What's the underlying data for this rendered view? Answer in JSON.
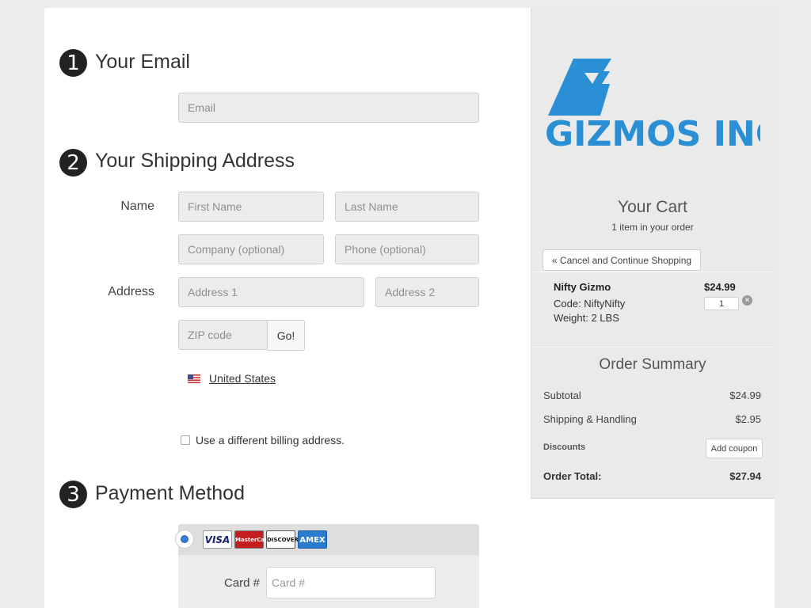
{
  "steps": [
    {
      "num": "1",
      "title": "Your Email"
    },
    {
      "num": "2",
      "title": "Your Shipping Address"
    },
    {
      "num": "3",
      "title": "Payment Method"
    }
  ],
  "email": {
    "placeholder": "Email"
  },
  "shipping": {
    "name_label": "Name",
    "address_label": "Address",
    "first_name_placeholder": "First Name",
    "last_name_placeholder": "Last Name",
    "company_placeholder": "Company (optional)",
    "phone_placeholder": "Phone (optional)",
    "address1_placeholder": "Address 1",
    "address2_placeholder": "Address 2",
    "zip_placeholder": "ZIP code",
    "go_label": "Go!",
    "country": "United States",
    "billing_checkbox_label": "Use a different billing address."
  },
  "payment": {
    "cards": [
      "VISA",
      "MasterCard",
      "DISCOVER",
      "AMEX"
    ],
    "card_label": "Card #",
    "card_placeholder": "Card #"
  },
  "sidebar": {
    "brand": "GIZMOS INC",
    "brand_color": "#2a8fd4",
    "cart_title": "Your Cart",
    "cart_subtitle": "1 item in your order",
    "cancel_label": "« Cancel and Continue Shopping",
    "item": {
      "name": "Nifty Gizmo",
      "price": "$24.99",
      "code": "Code: NiftyNifty",
      "weight": "Weight: 2 LBS",
      "qty": "1"
    },
    "summary_title": "Order Summary",
    "subtotal_label": "Subtotal",
    "subtotal_value": "$24.99",
    "shipping_label": "Shipping & Handling",
    "shipping_value": "$2.95",
    "discounts_label": "Discounts",
    "coupon_label": "Add coupon",
    "total_label": "Order Total:",
    "total_value": "$27.94"
  }
}
